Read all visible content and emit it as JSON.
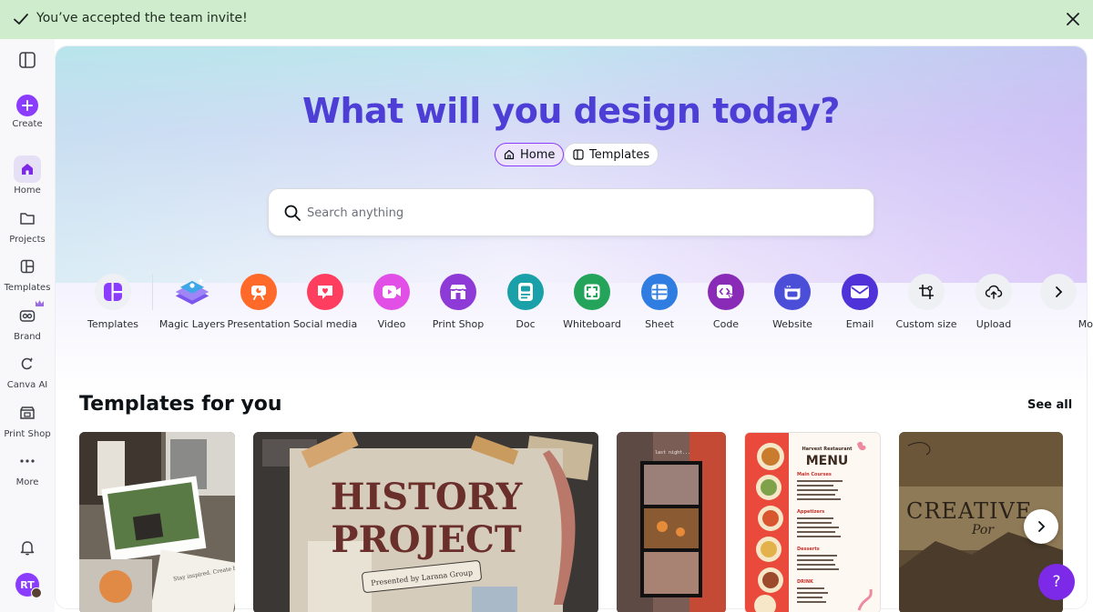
{
  "banner": {
    "message": "You’ve accepted the team invite!"
  },
  "sidebar": {
    "items": [
      {
        "label": "Create",
        "icon": "plus-icon"
      },
      {
        "label": "Home",
        "icon": "home-icon"
      },
      {
        "label": "Projects",
        "icon": "folder-icon"
      },
      {
        "label": "Templates",
        "icon": "templates-icon"
      },
      {
        "label": "Brand",
        "icon": "brand-icon"
      },
      {
        "label": "Canva AI",
        "icon": "canva-ai-icon"
      },
      {
        "label": "Print Shop",
        "icon": "print-shop-icon"
      },
      {
        "label": "More",
        "icon": "more-dots-icon"
      }
    ],
    "avatar_initials": "RT"
  },
  "hero": {
    "title": "What will you design today?",
    "tabs": [
      {
        "label": "Home",
        "active": true
      },
      {
        "label": "Templates",
        "active": false
      }
    ]
  },
  "search": {
    "placeholder": "Search anything",
    "value": ""
  },
  "categories": [
    {
      "label": "Templates",
      "color": "#8b3dff",
      "icon": "templates-icon"
    },
    {
      "label": "Magic Layers",
      "color": "#6b4cf0",
      "icon": "magic-layers-icon"
    },
    {
      "label": "Presentation",
      "color": "#ff6a2b",
      "icon": "presentation-icon"
    },
    {
      "label": "Social media",
      "color": "#ff3d5e",
      "icon": "heart-icon"
    },
    {
      "label": "Video",
      "color": "#e14fe6",
      "icon": "video-icon"
    },
    {
      "label": "Print Shop",
      "color": "#8d3ad6",
      "icon": "shop-icon"
    },
    {
      "label": "Doc",
      "color": "#1aa0a8",
      "icon": "doc-icon"
    },
    {
      "label": "Whiteboard",
      "color": "#24a35a",
      "icon": "whiteboard-icon"
    },
    {
      "label": "Sheet",
      "color": "#2f7de0",
      "icon": "sheet-icon"
    },
    {
      "label": "Code",
      "color": "#8a2bb8",
      "icon": "code-icon"
    },
    {
      "label": "Website",
      "color": "#4b4fd8",
      "icon": "website-icon"
    },
    {
      "label": "Email",
      "color": "#4f33d9",
      "icon": "email-icon"
    },
    {
      "label": "Custom size",
      "color": "#eef0f3",
      "icon": "custom-size-icon"
    },
    {
      "label": "Upload",
      "color": "#eef0f3",
      "icon": "upload-cloud-icon"
    },
    {
      "label": "Mo",
      "color": "#eef0f3",
      "icon": "chevron-right-icon"
    }
  ],
  "templates_section": {
    "title": "Templates for you",
    "see_all": "See all",
    "cards": [
      {
        "type": "photo-collage",
        "text": "Stay inspired. Create boldly. Move with vision."
      },
      {
        "type": "presentation",
        "text": "HISTORY PROJECT",
        "subtext": "Presented by Larana Group"
      },
      {
        "type": "photo-strip",
        "text": "last night..."
      },
      {
        "type": "menu",
        "text": "MENU",
        "header": "Harvest Restaurant",
        "sections": [
          "Main Courses",
          "Appetizers",
          "Desserts",
          "DRINK"
        ]
      },
      {
        "type": "portfolio",
        "text": "CREATIVE",
        "subtext": "Por"
      }
    ]
  }
}
